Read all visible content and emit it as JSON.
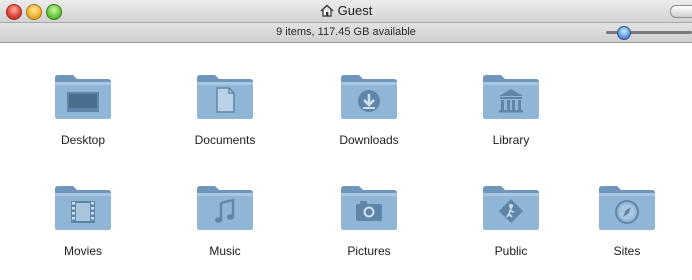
{
  "window": {
    "title": "Guest",
    "status": "9 items, 117.45 GB available",
    "icon_size_slider_level": 0.2
  },
  "items": [
    {
      "label": "Desktop",
      "icon": "desktop-folder-icon"
    },
    {
      "label": "Documents",
      "icon": "documents-folder-icon"
    },
    {
      "label": "Downloads",
      "icon": "downloads-folder-icon"
    },
    {
      "label": "Library",
      "icon": "library-folder-icon"
    },
    {
      "label": "Movies",
      "icon": "movies-folder-icon"
    },
    {
      "label": "Music",
      "icon": "music-folder-icon"
    },
    {
      "label": "Pictures",
      "icon": "pictures-folder-icon"
    },
    {
      "label": "Public",
      "icon": "public-folder-icon"
    },
    {
      "label": "Sites",
      "icon": "sites-folder-icon"
    }
  ],
  "colors": {
    "folder": "#8fb6d6",
    "folder_dark": "#6e97bb",
    "emblem": "#5f86a8"
  }
}
